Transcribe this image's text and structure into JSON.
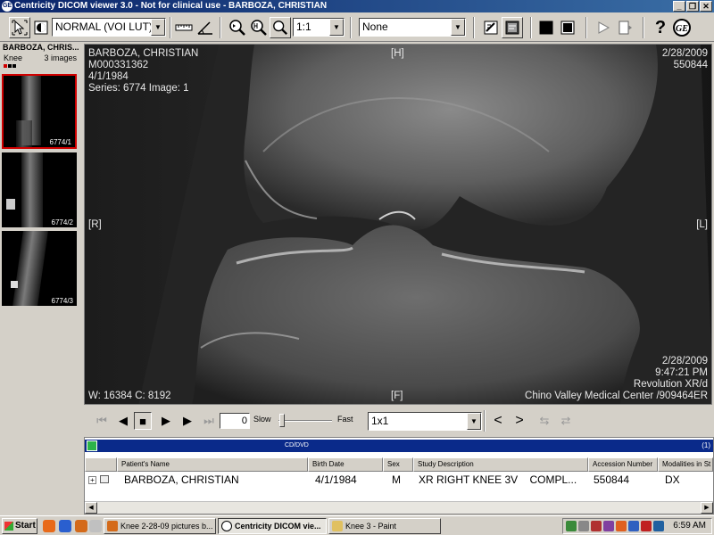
{
  "window": {
    "title": "Centricity DICOM viewer 3.0 - Not for clinical use - BARBOZA, CHRISTIAN",
    "minimize": "_",
    "restore": "❐",
    "close": "✕"
  },
  "toolbar": {
    "wl_preset": "NORMAL (VOI LUT)",
    "zoom": "1:1",
    "annotation": "None",
    "help": "?",
    "ge": "GE"
  },
  "thumbs": {
    "patient": "BARBOZA, CHRIS...",
    "series_name": "Knee",
    "count": "3 images",
    "items": [
      {
        "label": "6774/1"
      },
      {
        "label": "6774/2"
      },
      {
        "label": "6774/3"
      }
    ]
  },
  "overlay": {
    "patient_name": "BARBOZA, CHRISTIAN",
    "patient_id": "M000331362",
    "dob": "4/1/1984",
    "series_image": "Series: 6774 Image: 1",
    "marker_top": "[H]",
    "marker_left": "[R]",
    "marker_right": "[L]",
    "marker_bottom": "[F]",
    "study_date_top": "2/28/2009",
    "accession": "550844",
    "study_date_bottom": "2/28/2009",
    "time": "9:47:21 PM",
    "device": "Revolution XR/d",
    "institution": "Chino Valley Medical Center /909464ER",
    "window_level": "W: 16384 C: 8192"
  },
  "cine": {
    "frame": "0",
    "slow": "Slow",
    "fast": "Fast",
    "layout": "1x1"
  },
  "studies": {
    "source": "CD/DVD",
    "count": "(1)",
    "columns": [
      "Patient's Name",
      "Birth Date",
      "Sex",
      "Study Description",
      "Accession Number",
      "Modalities in St"
    ],
    "row": {
      "name": "BARBOZA, CHRISTIAN",
      "birth": "4/1/1984",
      "sex": "M",
      "description": "XR RIGHT KNEE 3V    COMPL...",
      "accession": "550844",
      "modality": "DX"
    }
  },
  "taskbar": {
    "start": "Start",
    "tasks": [
      {
        "label": "Knee 2-28-09 pictures b..."
      },
      {
        "label": "Centricity DICOM vie..."
      },
      {
        "label": "Knee 3 - Paint"
      }
    ],
    "clock": "6:59 AM"
  }
}
